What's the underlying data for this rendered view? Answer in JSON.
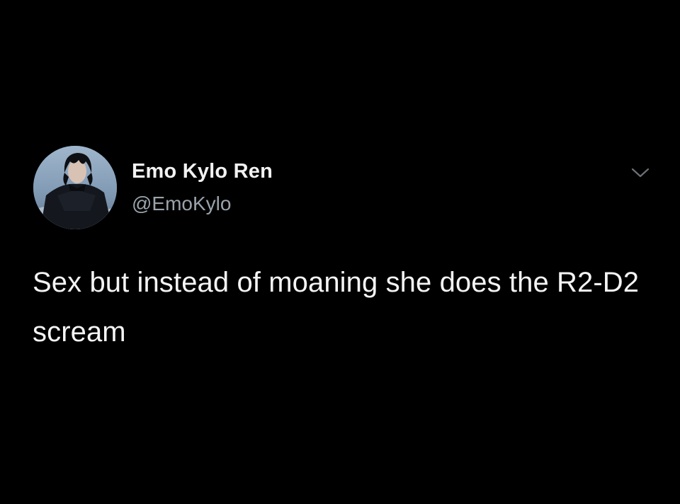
{
  "tweet": {
    "author": {
      "display_name": "Emo Kylo Ren",
      "handle": "@EmoKylo"
    },
    "text": "Sex but instead of moaning she does the R2-D2 scream",
    "menu_icon": "chevron-down-icon"
  },
  "colors": {
    "background": "#000000",
    "primary_text": "#f4f4f4",
    "secondary_text": "#9aa3ab",
    "chevron": "#6b7178"
  }
}
